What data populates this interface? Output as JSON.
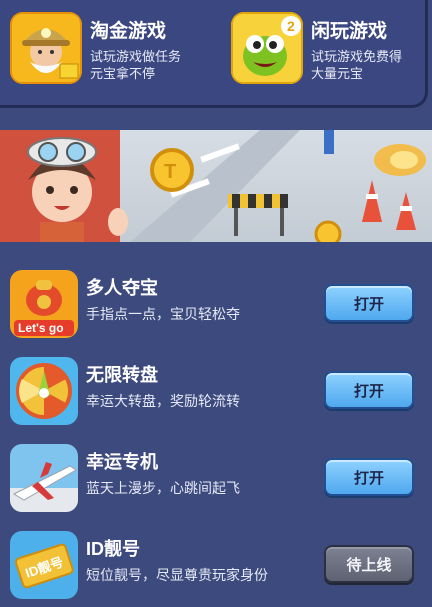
{
  "top_games": [
    {
      "title": "淘金游戏",
      "desc": "试玩游戏做任务元宝拿不停",
      "icon": "gold-miner-icon"
    },
    {
      "title": "闲玩游戏",
      "desc": "试玩游戏免费得大量元宝",
      "icon": "green-monster-icon"
    }
  ],
  "banner": {
    "icon": "pilot-character-banner"
  },
  "list": [
    {
      "title": "多人夺宝",
      "desc": "手指点一点，宝贝轻松夺",
      "button": "打开",
      "icon_text": "Let's go",
      "icon": "treasure-bag-icon"
    },
    {
      "title": "无限转盘",
      "desc": "幸运大转盘，奖励轮流转",
      "button": "打开",
      "icon": "wheel-icon"
    },
    {
      "title": "幸运专机",
      "desc": "蓝天上漫步，心跳间起飞",
      "button": "打开",
      "icon": "airplane-icon"
    },
    {
      "title": "ID靓号",
      "desc": "短位靓号，尽显尊贵玩家身份",
      "button": "待上线",
      "icon_text": "ID靓号",
      "icon": "id-ticket-icon"
    }
  ],
  "colors": {
    "background": "#3d4a7e",
    "open_button": "#5fb3f2",
    "pending_button": "#6b6f80"
  }
}
